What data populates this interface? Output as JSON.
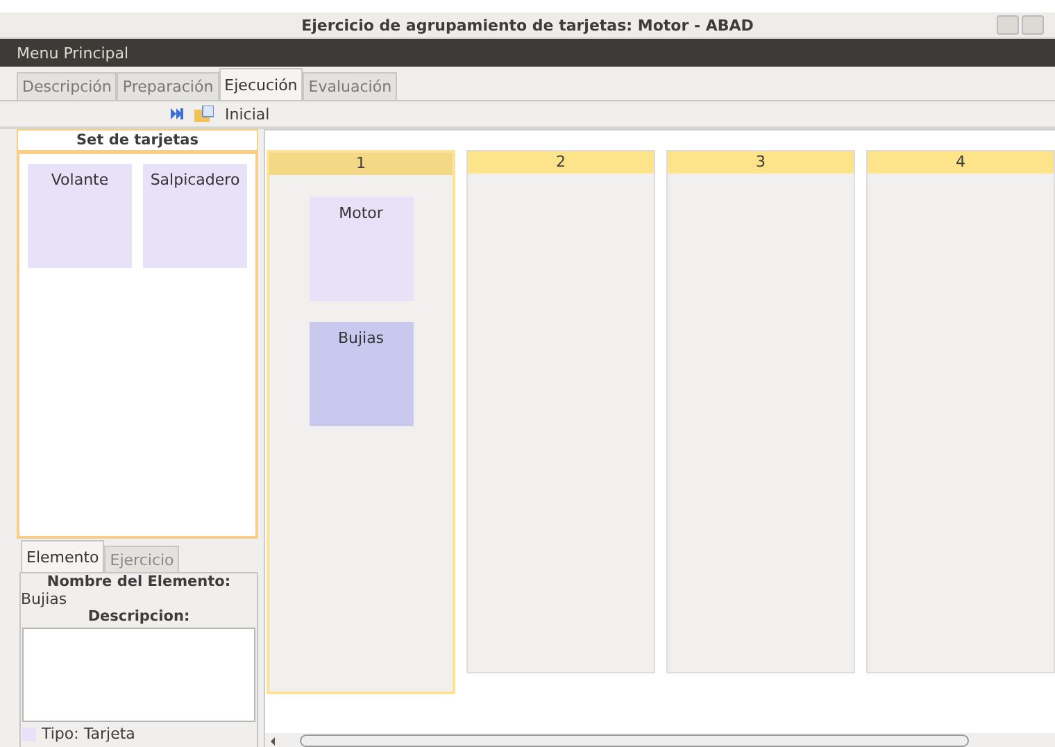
{
  "window": {
    "title": "Ejercicio de agrupamiento de tarjetas: Motor - ABAD"
  },
  "menu": {
    "label": "Menu Principal"
  },
  "tabs": [
    {
      "label": "Descripción",
      "selected": false
    },
    {
      "label": "Preparación",
      "selected": false
    },
    {
      "label": "Ejecución",
      "selected": true
    },
    {
      "label": "Evaluación",
      "selected": false
    }
  ],
  "toolbar": {
    "label": "Inicial"
  },
  "card_set": {
    "title": "Set de tarjetas",
    "cards": [
      {
        "label": "Volante",
        "selected": false
      },
      {
        "label": "Salpicadero",
        "selected": false
      }
    ]
  },
  "detail_tabs": [
    {
      "label": "Elemento",
      "selected": true
    },
    {
      "label": "Ejercicio",
      "selected": false
    }
  ],
  "element": {
    "name_label": "Nombre del Elemento:",
    "name": "Bujias",
    "description_label": "Descripcion:",
    "type": "Tipo: Tarjeta"
  },
  "groups": [
    {
      "title": "1",
      "selected": true,
      "cards": [
        {
          "label": "Motor",
          "selected": false
        },
        {
          "label": "Bujias",
          "selected": true
        }
      ]
    },
    {
      "title": "2",
      "selected": false
    },
    {
      "title": "3",
      "selected": false
    },
    {
      "title": "4",
      "selected": false
    }
  ]
}
